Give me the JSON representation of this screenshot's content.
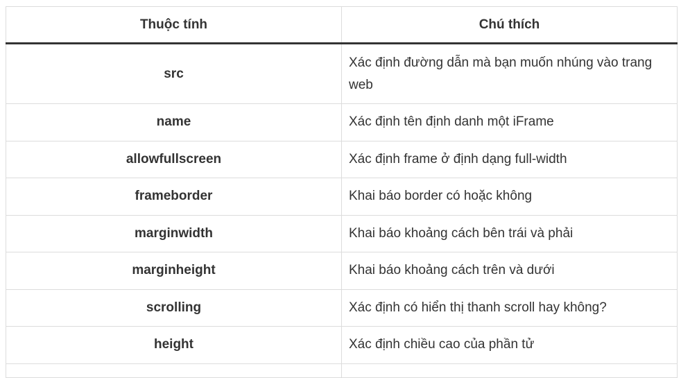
{
  "table": {
    "headers": [
      "Thuộc tính",
      "Chú thích"
    ],
    "rows": [
      {
        "attr": "src",
        "desc": "Xác định đường dẫn mà bạn muốn nhúng vào trang web"
      },
      {
        "attr": "name",
        "desc": "Xác định tên định danh một iFrame"
      },
      {
        "attr": "allowfullscreen",
        "desc": "Xác định frame ở định dạng full-width"
      },
      {
        "attr": "frameborder",
        "desc": "Khai báo border có hoặc không"
      },
      {
        "attr": "marginwidth",
        "desc": "Khai báo khoảng cách bên trái và phải"
      },
      {
        "attr": "marginheight",
        "desc": "Khai báo khoảng cách trên và dưới"
      },
      {
        "attr": "scrolling",
        "desc": "Xác định có hiển thị thanh scroll hay không?"
      },
      {
        "attr": "height",
        "desc": "Xác định chiều cao của phần tử"
      }
    ]
  }
}
